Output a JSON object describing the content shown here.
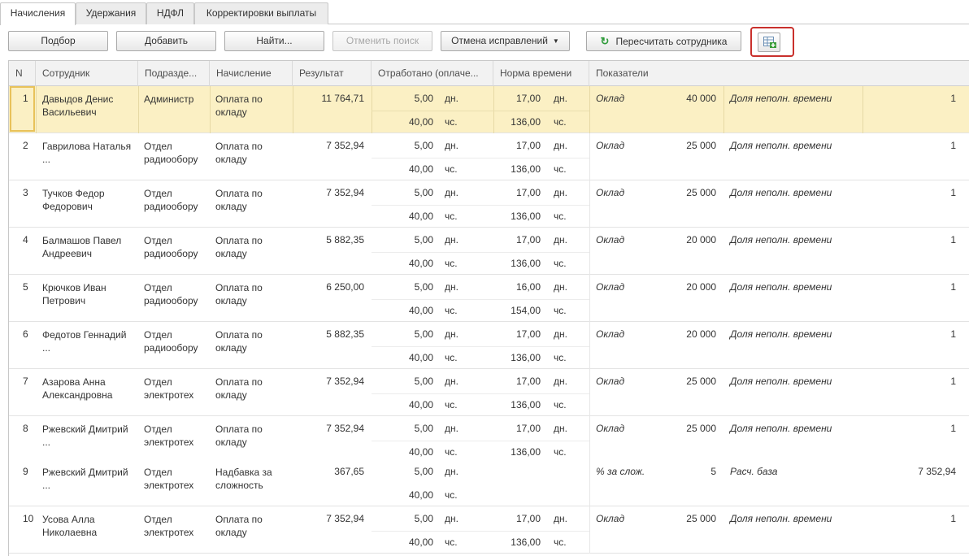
{
  "tabs": [
    {
      "label": "Начисления",
      "active": true
    },
    {
      "label": "Удержания",
      "active": false
    },
    {
      "label": "НДФЛ",
      "active": false
    },
    {
      "label": "Корректировки выплаты",
      "active": false
    }
  ],
  "toolbar": {
    "select_label": "Подбор",
    "add_label": "Добавить",
    "find_label": "Найти...",
    "cancel_search_label": "Отменить поиск",
    "cancel_corrections_label": "Отмена исправлений",
    "recalculate_label": "Пересчитать сотрудника",
    "icon_button": "table-add-icon"
  },
  "columns": {
    "n": "N",
    "employee": "Сотрудник",
    "department": "Подразде...",
    "accrual": "Начисление",
    "result": "Результат",
    "worked": "Отработано (оплаче...",
    "norm": "Норма времени",
    "indicators": "Показатели"
  },
  "rows": [
    {
      "n": "1",
      "employee": "Давыдов Денис Васильевич",
      "department": "Администр",
      "accrual": "Оплата по окладу",
      "result": "11 764,71",
      "worked_days": "5,00",
      "days_unit": "дн.",
      "worked_hours": "40,00",
      "hours_unit": "чс.",
      "norm_days": "17,00",
      "norm_days_unit": "дн.",
      "norm_hours": "136,00",
      "norm_hours_unit": "чс.",
      "ind1": "Оклад",
      "ind1_val": "40 000",
      "ind2": "Доля неполн. времени",
      "ind2_val": "1",
      "selected": true
    },
    {
      "n": "2",
      "employee": "Гаврилова Наталья ...",
      "department": "Отдел радиообору",
      "accrual": "Оплата по окладу",
      "result": "7 352,94",
      "worked_days": "5,00",
      "days_unit": "дн.",
      "worked_hours": "40,00",
      "hours_unit": "чс.",
      "norm_days": "17,00",
      "norm_days_unit": "дн.",
      "norm_hours": "136,00",
      "norm_hours_unit": "чс.",
      "ind1": "Оклад",
      "ind1_val": "25 000",
      "ind2": "Доля неполн. времени",
      "ind2_val": "1"
    },
    {
      "n": "3",
      "employee": "Тучков Федор Федорович",
      "department": "Отдел радиообору",
      "accrual": "Оплата по окладу",
      "result": "7 352,94",
      "worked_days": "5,00",
      "days_unit": "дн.",
      "worked_hours": "40,00",
      "hours_unit": "чс.",
      "norm_days": "17,00",
      "norm_days_unit": "дн.",
      "norm_hours": "136,00",
      "norm_hours_unit": "чс.",
      "ind1": "Оклад",
      "ind1_val": "25 000",
      "ind2": "Доля неполн. времени",
      "ind2_val": "1"
    },
    {
      "n": "4",
      "employee": "Балмашов Павел Андреевич",
      "department": "Отдел радиообору",
      "accrual": "Оплата по окладу",
      "result": "5 882,35",
      "worked_days": "5,00",
      "days_unit": "дн.",
      "worked_hours": "40,00",
      "hours_unit": "чс.",
      "norm_days": "17,00",
      "norm_days_unit": "дн.",
      "norm_hours": "136,00",
      "norm_hours_unit": "чс.",
      "ind1": "Оклад",
      "ind1_val": "20 000",
      "ind2": "Доля неполн. времени",
      "ind2_val": "1"
    },
    {
      "n": "5",
      "employee": "Крючков Иван Петрович",
      "department": "Отдел радиообору",
      "accrual": "Оплата по окладу",
      "result": "6 250,00",
      "worked_days": "5,00",
      "days_unit": "дн.",
      "worked_hours": "40,00",
      "hours_unit": "чс.",
      "norm_days": "16,00",
      "norm_days_unit": "дн.",
      "norm_hours": "154,00",
      "norm_hours_unit": "чс.",
      "ind1": "Оклад",
      "ind1_val": "20 000",
      "ind2": "Доля неполн. времени",
      "ind2_val": "1"
    },
    {
      "n": "6",
      "employee": "Федотов Геннадий ...",
      "department": "Отдел радиообору",
      "accrual": "Оплата по окладу",
      "result": "5 882,35",
      "worked_days": "5,00",
      "days_unit": "дн.",
      "worked_hours": "40,00",
      "hours_unit": "чс.",
      "norm_days": "17,00",
      "norm_days_unit": "дн.",
      "norm_hours": "136,00",
      "norm_hours_unit": "чс.",
      "ind1": "Оклад",
      "ind1_val": "20 000",
      "ind2": "Доля неполн. времени",
      "ind2_val": "1"
    },
    {
      "n": "7",
      "employee": "Азарова Анна Александровна",
      "department": "Отдел электротех",
      "accrual": "Оплата по окладу",
      "result": "7 352,94",
      "worked_days": "5,00",
      "days_unit": "дн.",
      "worked_hours": "40,00",
      "hours_unit": "чс.",
      "norm_days": "17,00",
      "norm_days_unit": "дн.",
      "norm_hours": "136,00",
      "norm_hours_unit": "чс.",
      "ind1": "Оклад",
      "ind1_val": "25 000",
      "ind2": "Доля неполн. времени",
      "ind2_val": "1"
    },
    {
      "n": "8",
      "employee": "Ржевский Дмитрий ...",
      "department": "Отдел электротех",
      "accrual": "Оплата по окладу",
      "result": "7 352,94",
      "worked_days": "5,00",
      "days_unit": "дн.",
      "worked_hours": "40,00",
      "hours_unit": "чс.",
      "norm_days": "17,00",
      "norm_days_unit": "дн.",
      "norm_hours": "136,00",
      "norm_hours_unit": "чс.",
      "ind1": "Оклад",
      "ind1_val": "25 000",
      "ind2": "Доля неполн. времени",
      "ind2_val": "1"
    },
    {
      "n": "9",
      "employee": "Ржевский Дмитрий ...",
      "department": "Отдел электротех",
      "accrual": "Надбавка за сложность",
      "result": "367,65",
      "worked_days": "5,00",
      "days_unit": "дн.",
      "worked_hours": "40,00",
      "hours_unit": "чс.",
      "norm_days": "",
      "norm_days_unit": "",
      "norm_hours": "",
      "norm_hours_unit": "",
      "ind1": "% за слож.",
      "ind1_val": "5",
      "ind2": "Расч. база",
      "ind2_val": "7 352,94",
      "no_divider": true
    },
    {
      "n": "10",
      "employee": "Усова Алла Николаевна",
      "department": "Отдел электротех",
      "accrual": "Оплата по окладу",
      "result": "7 352,94",
      "worked_days": "5,00",
      "days_unit": "дн.",
      "worked_hours": "40,00",
      "hours_unit": "чс.",
      "norm_days": "17,00",
      "norm_days_unit": "дн.",
      "norm_hours": "136,00",
      "norm_hours_unit": "чс.",
      "ind1": "Оклад",
      "ind1_val": "25 000",
      "ind2": "Доля неполн. времени",
      "ind2_val": "1"
    }
  ]
}
